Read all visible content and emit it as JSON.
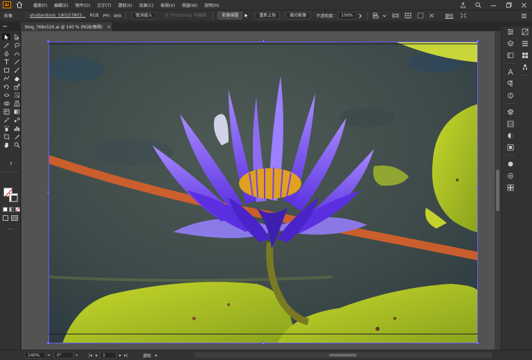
{
  "menubar": {
    "logo": "Ai",
    "items": [
      "檔案(F)",
      "編輯(E)",
      "物件(O)",
      "文字(T)",
      "選取(S)",
      "效果(C)",
      "檢視(V)",
      "視窗(W)",
      "說明(H)"
    ],
    "icons": [
      "share-icon",
      "search-icon",
      "minimize-icon",
      "restore-icon",
      "close-icon"
    ]
  },
  "controlbar": {
    "object_type": "影像",
    "filename": "shutterstock_190157803...",
    "color_mode": "RGB",
    "ppi": "PPI：469",
    "unembed_label": "取消嵌入",
    "edit_photoshop_label": "在 Photoshop 中編輯",
    "image_trace_label": "影像描圖",
    "recolor_label": "重新上色",
    "crop_label": "裁切影像",
    "opacity_label": "不透明度：",
    "opacity_value": "100%",
    "transform_label": "變形"
  },
  "tab": {
    "title": "blog_768x520.ai @ 140 % (RGB/預視)",
    "close": "×"
  },
  "toolbar": {
    "tools": [
      "selection-tool",
      "direct-selection-tool",
      "magic-wand-tool",
      "lasso-tool",
      "pen-tool",
      "curvature-tool",
      "type-tool",
      "line-tool",
      "rectangle-tool",
      "paintbrush-tool",
      "shaper-tool",
      "eraser-tool",
      "rotate-tool",
      "scale-tool",
      "width-tool",
      "free-transform-tool",
      "shape-builder-tool",
      "perspective-tool",
      "mesh-tool",
      "gradient-tool",
      "eyedropper-tool",
      "blend-tool",
      "symbol-sprayer-tool",
      "column-graph-tool",
      "artboard-tool",
      "slice-tool",
      "hand-tool",
      "zoom-tool"
    ],
    "help_glyph": "?"
  },
  "rightpanels": {
    "col1": [
      "properties-icon",
      "layers-icon",
      "libraries-icon",
      "character-icon",
      "paragraph-icon",
      "opentype-icon",
      "transform-icon",
      "appearance-icon",
      "graphic-styles-icon",
      "align-icon",
      "pathfinder-icon"
    ],
    "col2": [
      "color-icon",
      "color-guide-icon",
      "swatches-icon",
      "brushes-icon",
      "symbols-icon",
      "stroke-icon",
      "gradient-icon",
      "transparency-icon",
      "asset-export-icon",
      "artboards-icon"
    ]
  },
  "statusbar": {
    "zoom": "140%",
    "rotation": "0°",
    "artboard_number": "1",
    "mode_label": "選取"
  },
  "colors": {
    "app_bg": "#323232",
    "canvas_bg": "#535353",
    "selection_blue": "#6a5cff",
    "logo_orange": "#ff9a00"
  }
}
